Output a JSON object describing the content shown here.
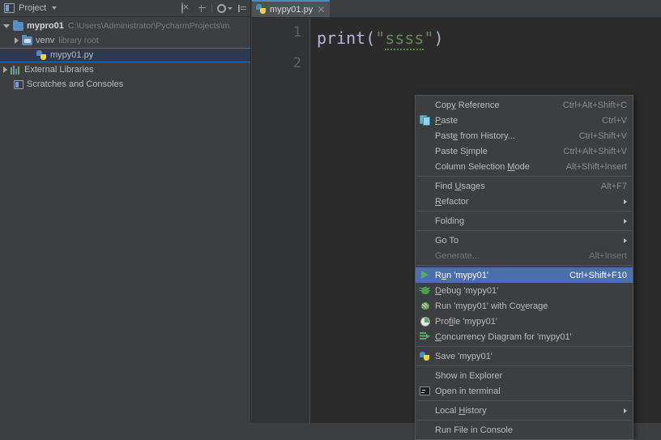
{
  "project_panel": {
    "title": "Project",
    "header_icons": [
      "project-icon",
      "chevron-down-icon",
      "hide-icon",
      "collapse-all-icon",
      "settings-gear-icon",
      "minimize-window-icon"
    ],
    "tree": [
      {
        "label": "mypro01",
        "secondary": "C:\\Users\\Administrator\\PycharmProjects\\m",
        "icon": "folder-icon",
        "expander": "expanded",
        "depth": 0,
        "bold": true,
        "selected": false
      },
      {
        "label": "venv",
        "secondary": "library root",
        "icon": "folder-library-icon",
        "expander": "collapsed",
        "depth": 1,
        "bold": false,
        "selected": false
      },
      {
        "label": "mypy01.py",
        "secondary": "",
        "icon": "python-file-icon",
        "expander": "none",
        "depth": 2,
        "bold": false,
        "selected": true
      },
      {
        "label": "External Libraries",
        "secondary": "",
        "icon": "libraries-icon",
        "expander": "collapsed",
        "depth": 0,
        "bold": false,
        "selected": false
      },
      {
        "label": "Scratches and Consoles",
        "secondary": "",
        "icon": "scratches-icon",
        "expander": "none",
        "depth": 0,
        "bold": false,
        "selected": false
      }
    ]
  },
  "editor": {
    "tab": {
      "label": "mypy01.py",
      "icon": "python-file-icon",
      "close_icon": "close-icon"
    },
    "line_numbers": [
      "1",
      "2"
    ],
    "code": {
      "fn": "print",
      "open_paren": "(",
      "quote_open": "\"",
      "string": "ssss",
      "quote_close": "\"",
      "close_paren": ")"
    }
  },
  "context_menu": {
    "items": [
      {
        "type": "item",
        "label": "Copy Reference",
        "mnemonic": "y",
        "accel": "Ctrl+Alt+Shift+C",
        "icon": "",
        "submenu": false,
        "selected": false,
        "disabled": false
      },
      {
        "type": "item",
        "label": "Paste",
        "mnemonic": "P",
        "accel": "Ctrl+V",
        "icon": "paste-icon",
        "submenu": false,
        "selected": false,
        "disabled": false
      },
      {
        "type": "item",
        "label": "Paste from History...",
        "mnemonic": "e",
        "accel": "Ctrl+Shift+V",
        "icon": "",
        "submenu": false,
        "selected": false,
        "disabled": false
      },
      {
        "type": "item",
        "label": "Paste Simple",
        "mnemonic": "i",
        "accel": "Ctrl+Alt+Shift+V",
        "icon": "",
        "submenu": false,
        "selected": false,
        "disabled": false
      },
      {
        "type": "item",
        "label": "Column Selection Mode",
        "mnemonic": "M",
        "accel": "Alt+Shift+Insert",
        "icon": "",
        "submenu": false,
        "selected": false,
        "disabled": false
      },
      {
        "type": "separator"
      },
      {
        "type": "item",
        "label": "Find Usages",
        "mnemonic": "U",
        "accel": "Alt+F7",
        "icon": "",
        "submenu": false,
        "selected": false,
        "disabled": false
      },
      {
        "type": "item",
        "label": "Refactor",
        "mnemonic": "R",
        "accel": "",
        "icon": "",
        "submenu": true,
        "selected": false,
        "disabled": false
      },
      {
        "type": "separator"
      },
      {
        "type": "item",
        "label": "Folding",
        "mnemonic": "",
        "accel": "",
        "icon": "",
        "submenu": true,
        "selected": false,
        "disabled": false
      },
      {
        "type": "separator"
      },
      {
        "type": "item",
        "label": "Go To",
        "mnemonic": "",
        "accel": "",
        "icon": "",
        "submenu": true,
        "selected": false,
        "disabled": false
      },
      {
        "type": "item",
        "label": "Generate...",
        "mnemonic": "",
        "accel": "Alt+Insert",
        "icon": "",
        "submenu": false,
        "selected": false,
        "disabled": true
      },
      {
        "type": "separator"
      },
      {
        "type": "item",
        "label": "Run 'mypy01'",
        "mnemonic": "u",
        "accel": "Ctrl+Shift+F10",
        "icon": "run-icon",
        "submenu": false,
        "selected": true,
        "disabled": false
      },
      {
        "type": "item",
        "label": "Debug 'mypy01'",
        "mnemonic": "D",
        "accel": "",
        "icon": "debug-icon",
        "submenu": false,
        "selected": false,
        "disabled": false
      },
      {
        "type": "item",
        "label": "Run 'mypy01' with Coverage",
        "mnemonic": "v",
        "accel": "",
        "icon": "coverage-icon",
        "submenu": false,
        "selected": false,
        "disabled": false
      },
      {
        "type": "item",
        "label": "Profile 'mypy01'",
        "mnemonic": "fi",
        "accel": "",
        "icon": "profile-icon",
        "submenu": false,
        "selected": false,
        "disabled": false
      },
      {
        "type": "item",
        "label": "Concurrency Diagram for 'mypy01'",
        "mnemonic": "C",
        "accel": "",
        "icon": "concurrency-icon",
        "submenu": false,
        "selected": false,
        "disabled": false
      },
      {
        "type": "separator"
      },
      {
        "type": "item",
        "label": "Save 'mypy01'",
        "mnemonic": "",
        "accel": "",
        "icon": "save-python-icon",
        "submenu": false,
        "selected": false,
        "disabled": false
      },
      {
        "type": "separator"
      },
      {
        "type": "item",
        "label": "Show in Explorer",
        "mnemonic": "",
        "accel": "",
        "icon": "",
        "submenu": false,
        "selected": false,
        "disabled": false
      },
      {
        "type": "item",
        "label": "Open in terminal",
        "mnemonic": "",
        "accel": "",
        "icon": "terminal-icon",
        "submenu": false,
        "selected": false,
        "disabled": false
      },
      {
        "type": "separator"
      },
      {
        "type": "item",
        "label": "Local History",
        "mnemonic": "H",
        "accel": "",
        "icon": "",
        "submenu": true,
        "selected": false,
        "disabled": false
      },
      {
        "type": "separator"
      },
      {
        "type": "item",
        "label": "Run File in Console",
        "mnemonic": "",
        "accel": "",
        "icon": "",
        "submenu": false,
        "selected": false,
        "disabled": false
      }
    ]
  },
  "colors": {
    "panel_bg": "#3c3f41",
    "editor_bg": "#2b2b2b",
    "gutter_bg": "#313335",
    "menu_bg": "#3c3f41",
    "selection_blue": "#4b6eaf",
    "tree_selection": "#2d3a4f",
    "tab_active": "#4e5254",
    "tab_underline": "#4a88c7",
    "text": "#bbbbbb",
    "accel_text": "#8c8c8c",
    "string_green": "#6a8759",
    "function_lavender": "#b5b6e3"
  }
}
